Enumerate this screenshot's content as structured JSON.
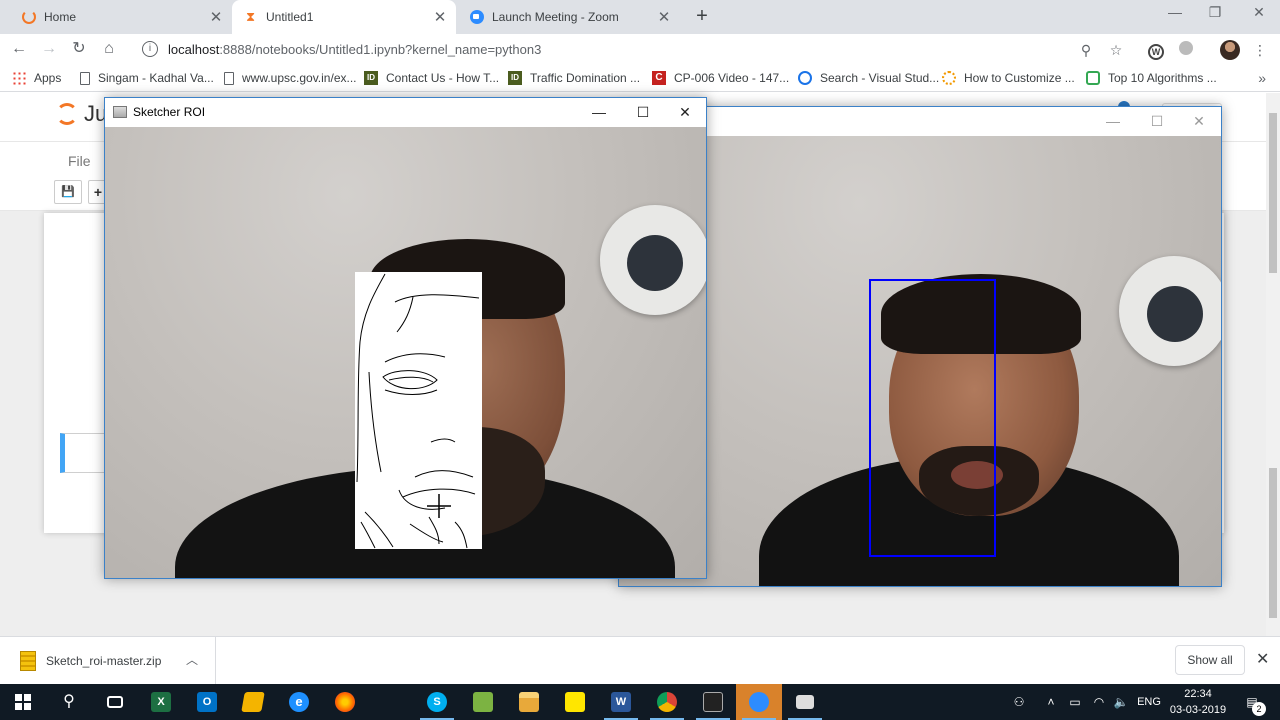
{
  "browser": {
    "tabs": [
      {
        "title": "Home",
        "active": false
      },
      {
        "title": "Untitled1",
        "active": true
      },
      {
        "title": "Launch Meeting - Zoom",
        "active": false
      }
    ],
    "new_tab_glyph": "+",
    "address": {
      "host": "localhost",
      "rest": ":8888/notebooks/Untitled1.ipynb?kernel_name=python3"
    },
    "bookmarks": [
      {
        "label": "Apps",
        "icon": "apps-grid-icon"
      },
      {
        "label": "Singam - Kadhal Va...",
        "icon": "page-icon"
      },
      {
        "label": "www.upsc.gov.in/ex...",
        "icon": "page-icon"
      },
      {
        "label": "Contact Us - How T...",
        "icon": "id-icon"
      },
      {
        "label": "Traffic Domination ...",
        "icon": "id-icon"
      },
      {
        "label": "CP-006 Video - 147...",
        "icon": "c-icon"
      },
      {
        "label": "Search - Visual Stud...",
        "icon": "visual-studio-icon"
      },
      {
        "label": "How to Customize ...",
        "icon": "sun-icon"
      },
      {
        "label": "Top 10 Algorithms ...",
        "icon": "geeks-icon"
      }
    ],
    "bookmarks_more": "»"
  },
  "jupyter": {
    "menu_file": "File",
    "logo_text": "Ju"
  },
  "sketch_window": {
    "title": "Sketcher ROI"
  },
  "camera_window": {
    "title": ""
  },
  "downloads": {
    "file_name": "Sketch_roi-master.zip",
    "show_all": "Show all"
  },
  "taskbar": {
    "apps": [
      "start-icon",
      "search-icon",
      "task-view-icon",
      "excel-icon",
      "outlook-icon",
      "explorer-pinned-icon",
      "edge-icon",
      "firefox-icon",
      "skype-icon",
      "notepad-icon",
      "file-explorer-icon",
      "sticky-notes-icon",
      "word-icon",
      "chrome-icon",
      "cmd-icon",
      "zoom-icon",
      "python-window-icon"
    ],
    "language": "ENG",
    "time": "22:34",
    "date": "03-03-2019",
    "notification_count": "2"
  },
  "colors": {
    "face_box": "#0000ff",
    "taskbar": "#101a24",
    "jupyter_orange": "#f37726"
  }
}
